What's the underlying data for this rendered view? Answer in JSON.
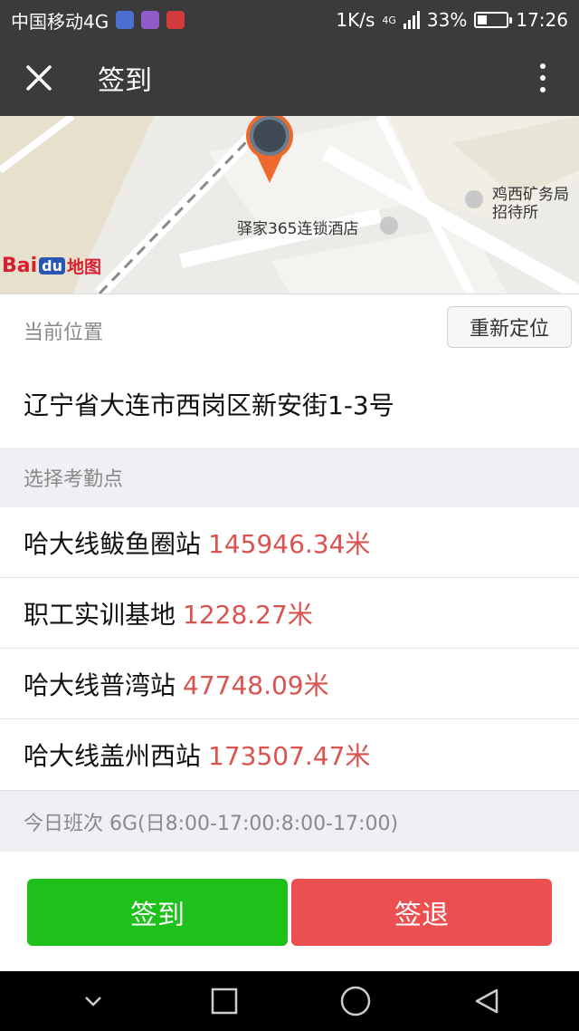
{
  "status_bar": {
    "carrier": "中国移动4G",
    "speed": "1K/s",
    "network": "4G",
    "battery_percent": "33%",
    "battery_level": 0.33,
    "time": "17:26"
  },
  "title_bar": {
    "title": "签到"
  },
  "map": {
    "poi_hotel": "驿家365连锁酒店",
    "poi_office_line1": "鸡西矿务局",
    "poi_office_line2": "招待所",
    "logo_bai": "Bai",
    "logo_du": "du",
    "logo_map": "地图"
  },
  "location": {
    "label": "当前位置",
    "relocate_button": "重新定位",
    "address": "辽宁省大连市西岗区新安街1-3号"
  },
  "checkpoints": {
    "label": "选择考勤点",
    "items": [
      {
        "name": "哈大线鲅鱼圈站",
        "distance": "145946.34米"
      },
      {
        "name": "职工实训基地",
        "distance": "1228.27米"
      },
      {
        "name": "哈大线普湾站",
        "distance": "47748.09米"
      },
      {
        "name": "哈大线盖州西站",
        "distance": "173507.47米"
      }
    ]
  },
  "shift": {
    "text": "今日班次 6G(日8:00-17:00:8:00-17:00)"
  },
  "actions": {
    "check_in": "签到",
    "check_out": "签退"
  },
  "colors": {
    "bar": "#3b3b3d",
    "check_in": "#1ec11a",
    "check_out": "#ec4f4f",
    "distance": "#d9534f"
  }
}
